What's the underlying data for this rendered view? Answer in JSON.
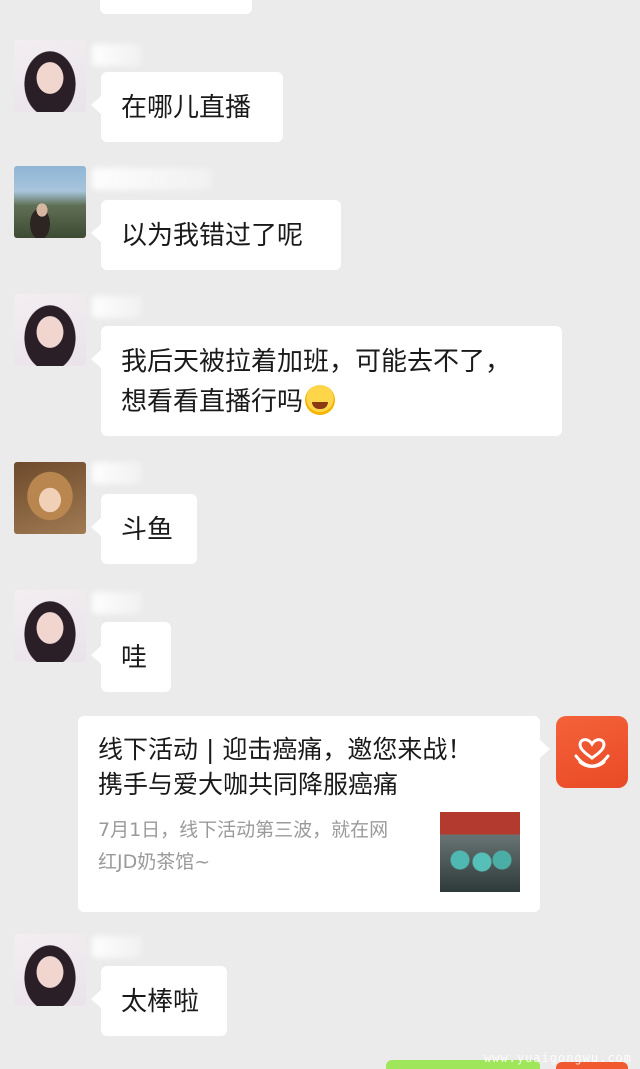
{
  "messages": [
    {
      "text": "在哪儿直播"
    },
    {
      "text": "以为我错过了呢"
    },
    {
      "line1": "我后天被拉着加班，可能去不了，",
      "line2": "想看看直播行吗"
    },
    {
      "text": "斗鱼"
    },
    {
      "text": "哇"
    },
    {
      "text": "太棒啦"
    }
  ],
  "share_card": {
    "title_line1": "线下活动 | 迎击癌痛，邀您来战！",
    "title_line2": "携手与爱大咖共同降服癌痛",
    "desc_line1": "7月1日，线下活动第三波，就在网",
    "desc_line2": "红JD奶茶馆~"
  },
  "watermark": "www.yuaigongwu.com",
  "colors": {
    "background": "#ebebeb",
    "bubble": "#ffffff",
    "app_icon": "#f15a30",
    "self_bubble": "#9fe65a"
  },
  "emoji_name": "tears-of-joy-emoji"
}
